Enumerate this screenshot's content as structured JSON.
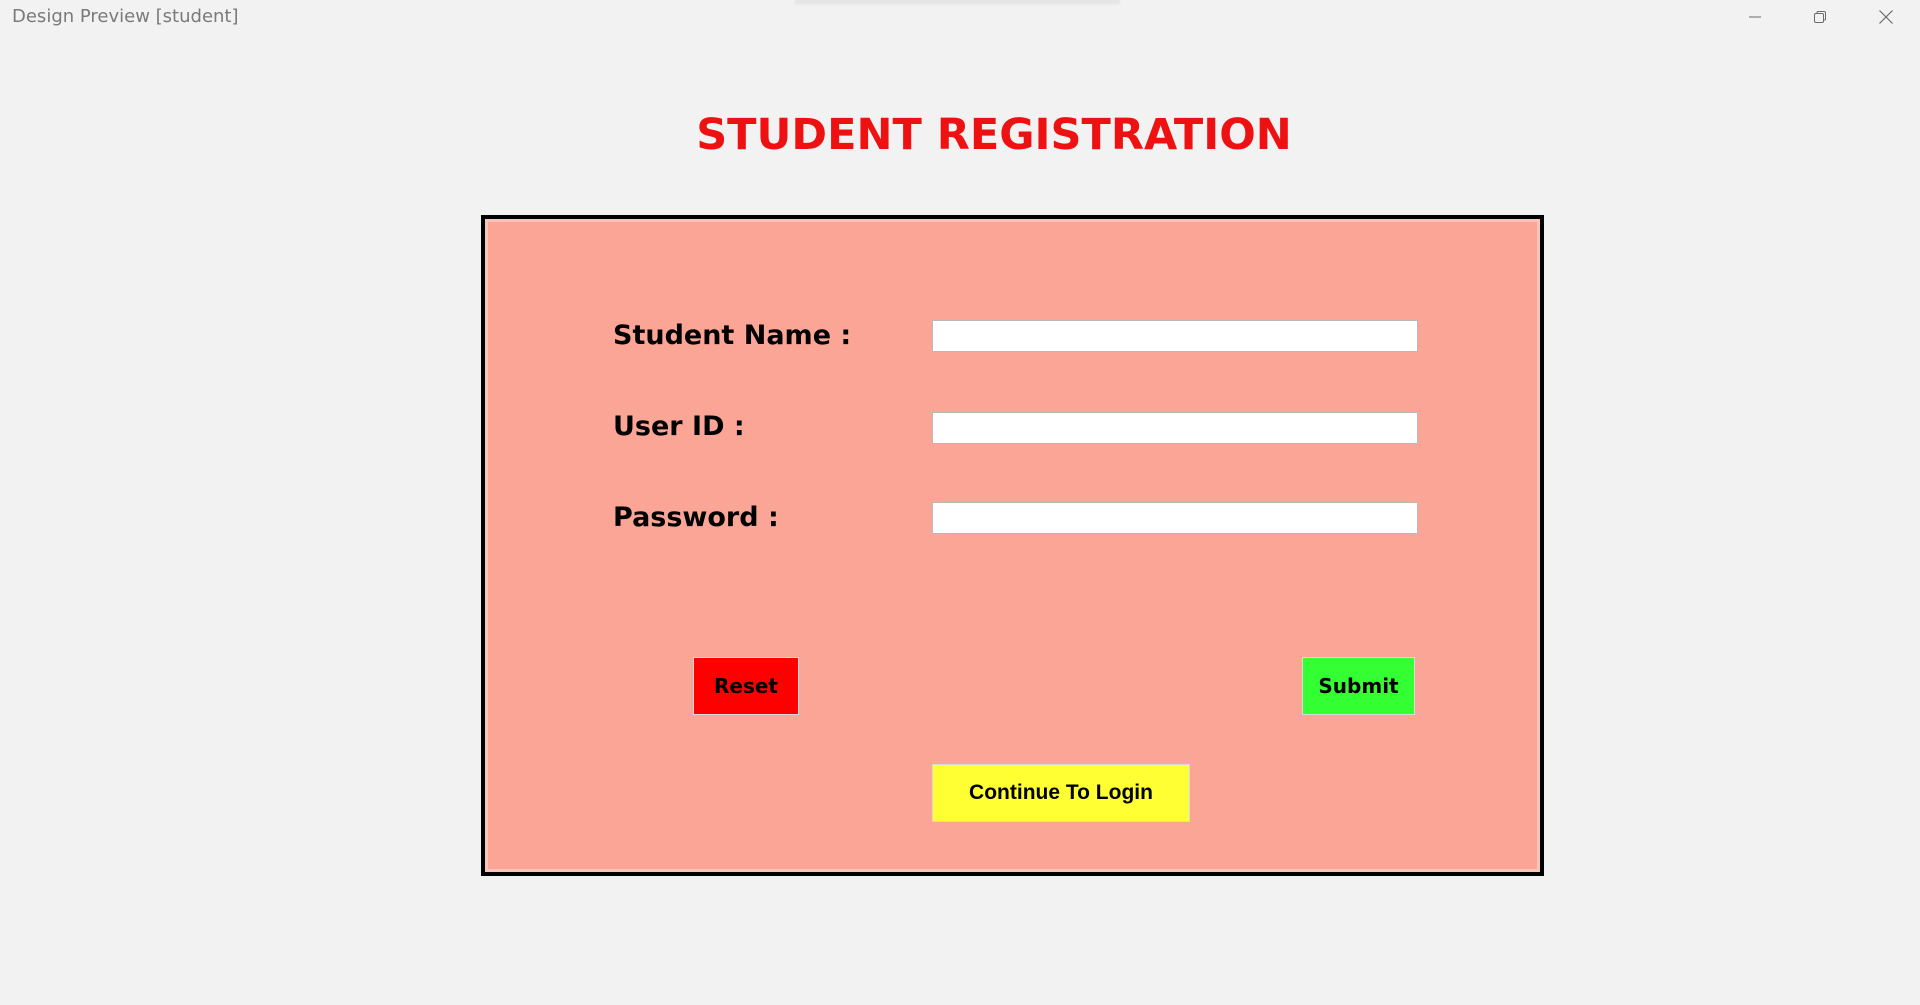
{
  "window": {
    "title": "Design Preview [student]",
    "controls": [
      "minimize-icon",
      "restore-icon",
      "close-icon"
    ]
  },
  "page": {
    "title": "STUDENT REGISTRATION"
  },
  "form": {
    "fields": [
      {
        "label": "Student Name :",
        "value": "",
        "placeholder": ""
      },
      {
        "label": "User ID :",
        "value": "",
        "placeholder": ""
      },
      {
        "label": "Password :",
        "value": "",
        "placeholder": ""
      }
    ],
    "buttons": {
      "reset": "Reset",
      "submit": "Submit",
      "continue_login": "Continue To Login"
    }
  },
  "colors": {
    "title": "#ee1111",
    "panel_background": "#fba596",
    "reset_button": "#ff0000",
    "submit_button": "#33ff33",
    "login_button": "#ffff33"
  }
}
